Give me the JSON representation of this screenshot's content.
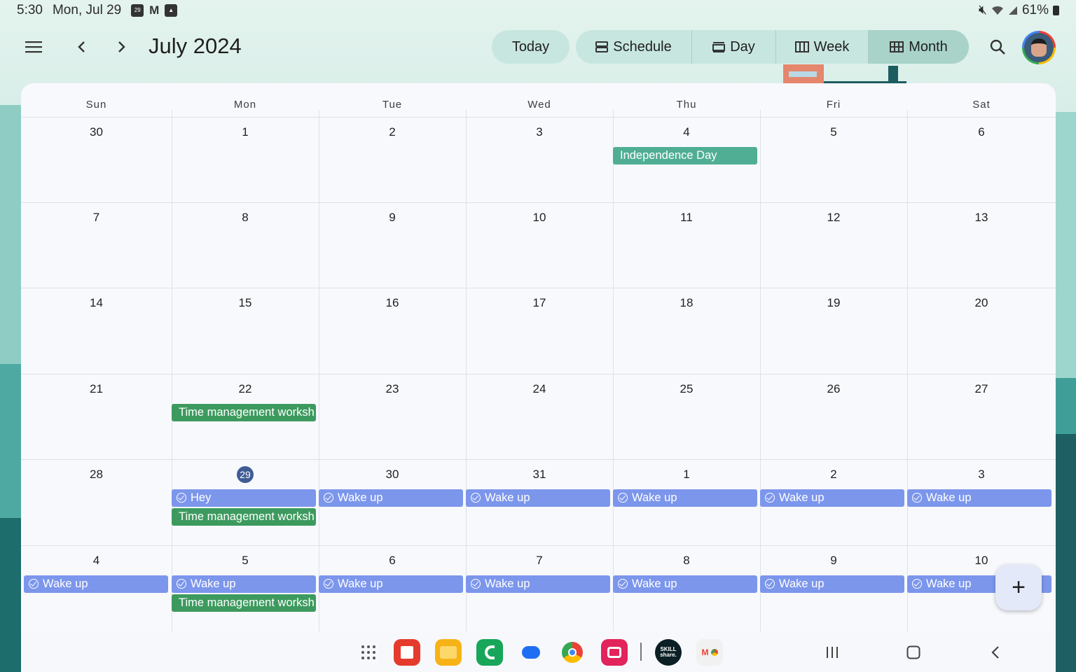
{
  "status_bar": {
    "time": "5:30",
    "date": "Mon, Jul 29",
    "notification_icons": [
      "calendar-icon",
      "gmail-icon",
      "photos-icon"
    ],
    "calendar_icon_text": "29",
    "system_icons": [
      "mute-icon",
      "wifi-icon",
      "signal-icon",
      "battery-icon"
    ],
    "battery": "61%"
  },
  "app_bar": {
    "title": "July 2024",
    "today_label": "Today",
    "views": [
      {
        "label": "Schedule",
        "icon": "schedule-icon"
      },
      {
        "label": "Day",
        "icon": "day-icon"
      },
      {
        "label": "Week",
        "icon": "week-icon"
      },
      {
        "label": "Month",
        "icon": "month-icon",
        "active": true
      }
    ]
  },
  "calendar": {
    "weekdays": [
      "Sun",
      "Mon",
      "Tue",
      "Wed",
      "Thu",
      "Fri",
      "Sat"
    ],
    "weeks": [
      {
        "days": [
          "30",
          "1",
          "2",
          "3",
          "4",
          "5",
          "6"
        ]
      },
      {
        "days": [
          "7",
          "8",
          "9",
          "10",
          "11",
          "12",
          "13"
        ]
      },
      {
        "days": [
          "14",
          "15",
          "16",
          "17",
          "18",
          "19",
          "20"
        ]
      },
      {
        "days": [
          "21",
          "22",
          "23",
          "24",
          "25",
          "26",
          "27"
        ]
      },
      {
        "days": [
          "28",
          "29",
          "30",
          "31",
          "1",
          "2",
          "3"
        ]
      },
      {
        "days": [
          "4",
          "5",
          "6",
          "7",
          "8",
          "9",
          "10"
        ]
      }
    ],
    "today": "29",
    "events": {
      "w0_thu": "Independence Day",
      "w3_mon": "Time management worksh",
      "w4_mon_task": "Hey",
      "w4_mon_event": "Time management worksh",
      "w4_tue": "Wake up",
      "w4_wed": "Wake up",
      "w4_thu": "Wake up",
      "w4_fri": "Wake up",
      "w4_sat": "Wake up",
      "w5_sun": "Wake up",
      "w5_mon_task": "Wake up",
      "w5_mon_event": "Time management worksh",
      "w5_tue": "Wake up",
      "w5_wed": "Wake up",
      "w5_thu": "Wake up",
      "w5_fri": "Wake up",
      "w5_sat": "Wake up"
    },
    "colors": {
      "holiday": "#4fae94",
      "event": "#3d9a5e",
      "task": "#7c96ec",
      "today_circle": "#3f5c94"
    }
  },
  "fab": {
    "label": "+"
  },
  "taskbar": {
    "apps": [
      "app-drawer-icon",
      "flipboard-icon",
      "my-files-icon",
      "phone-icon",
      "messages-icon",
      "chrome-icon",
      "screen-recorder-icon",
      "skillshare-icon",
      "gmail-chrome-pair-icon"
    ],
    "skillshare_text": "SKILL\nshare.",
    "nav": [
      "recents-icon",
      "home-icon",
      "back-icon"
    ]
  }
}
